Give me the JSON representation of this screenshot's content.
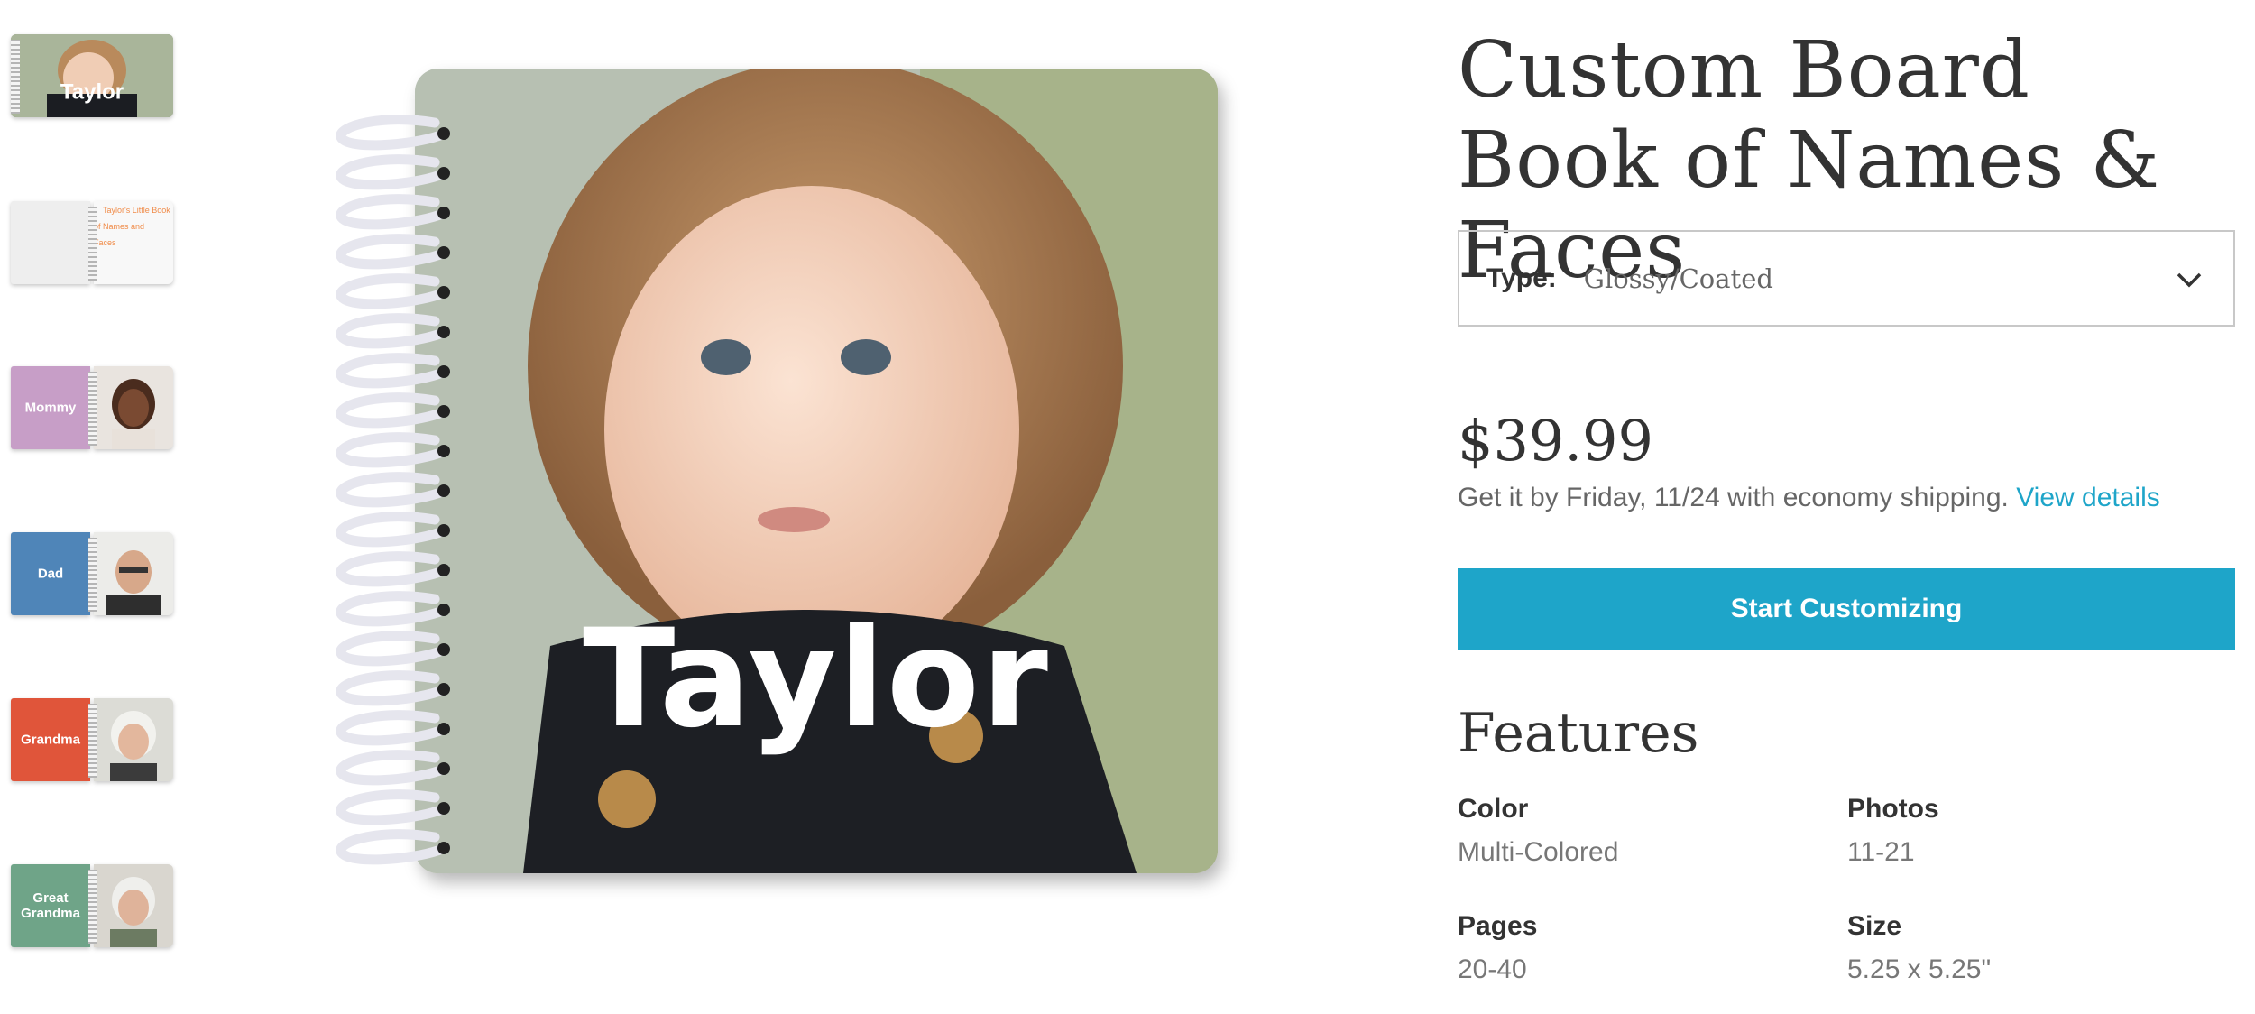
{
  "thumbnails": [
    {
      "label": "Taylor",
      "color": "#20242a"
    },
    {
      "label": "",
      "cover_text": "Taylor's Little Book of Names and Faces",
      "color": "#f1f1f1"
    },
    {
      "label": "Mommy",
      "color": "#c79ec7"
    },
    {
      "label": "Dad",
      "color": "#4f85b8"
    },
    {
      "label": "Grandma",
      "color": "#e0553a"
    },
    {
      "label": "Great Grandma",
      "color": "#6fa488"
    }
  ],
  "main_image": {
    "cover_name": "Taylor"
  },
  "product": {
    "title": "Custom Board Book of Names & Faces",
    "type_label": "Type:",
    "type_value": "Glossy/Coated",
    "price": "$39.99",
    "shipping_text": "Get it by Friday, 11/24 with economy shipping.",
    "shipping_link": "View details",
    "cta_label": "Start Customizing"
  },
  "features": {
    "heading": "Features",
    "items": [
      {
        "key": "Color",
        "value": "Multi-Colored"
      },
      {
        "key": "Photos",
        "value": "11-21"
      },
      {
        "key": "Pages",
        "value": "20-40"
      },
      {
        "key": "Size",
        "value": "5.25 x 5.25\""
      }
    ]
  },
  "colors": {
    "accent": "#1ea5c9",
    "text": "#333333",
    "muted": "#666666"
  }
}
